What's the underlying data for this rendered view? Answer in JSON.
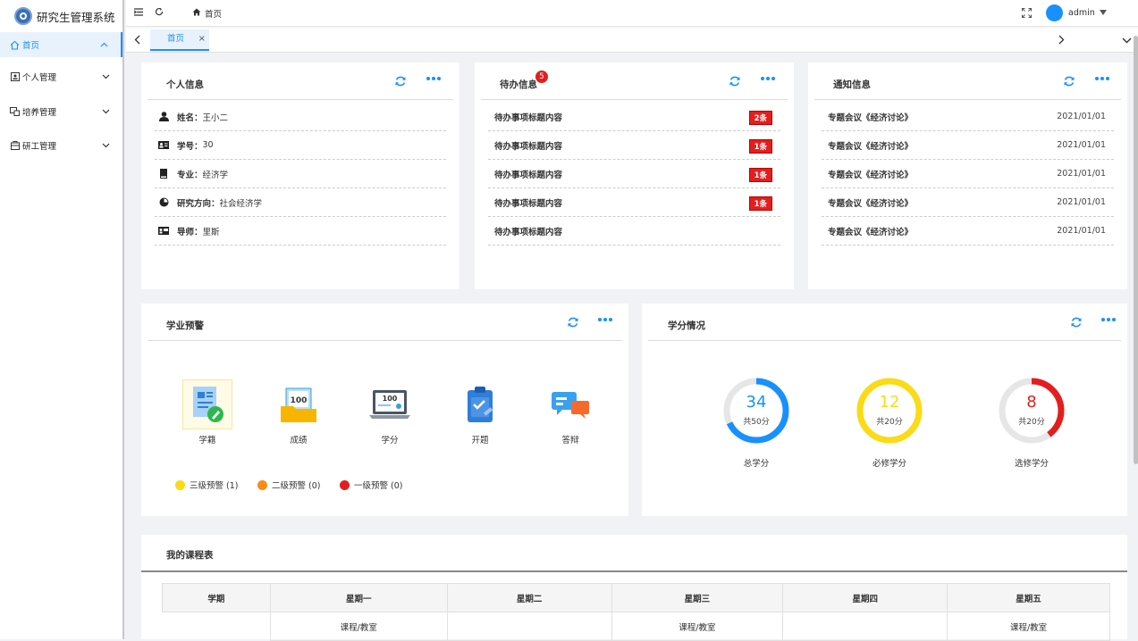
{
  "app": {
    "title": "研究生管理系统"
  },
  "sidebar": {
    "items": [
      {
        "label": "首页",
        "icon": "home-icon"
      },
      {
        "label": "个人管理",
        "icon": "person-card-icon"
      },
      {
        "label": "培养管理",
        "icon": "training-icon"
      },
      {
        "label": "研工管理",
        "icon": "research-icon"
      }
    ]
  },
  "topbar": {
    "breadcrumb": "首页",
    "user": "admin"
  },
  "tabs": [
    {
      "label": "首页",
      "close": "×"
    }
  ],
  "personal": {
    "title": "个人信息",
    "rows": [
      {
        "k": "姓名：",
        "v": "王小二"
      },
      {
        "k": "学号：",
        "v": "30"
      },
      {
        "k": "专业：",
        "v": "经济学"
      },
      {
        "k": "研究方向：",
        "v": "社会经济学"
      },
      {
        "k": "导师：",
        "v": "里斯"
      }
    ]
  },
  "todo": {
    "title": "待办信息",
    "count": "5",
    "rows": [
      {
        "text": "待办事项标题内容",
        "badge": "2条"
      },
      {
        "text": "待办事项标题内容",
        "badge": "1条"
      },
      {
        "text": "待办事项标题内容",
        "badge": "1条"
      },
      {
        "text": "待办事项标题内容",
        "badge": "1条"
      },
      {
        "text": "待办事项标题内容",
        "badge": ""
      }
    ]
  },
  "notice": {
    "title": "通知信息",
    "rows": [
      {
        "text": "专题会议《经济讨论》",
        "date": "2021/01/01"
      },
      {
        "text": "专题会议《经济讨论》",
        "date": "2021/01/01"
      },
      {
        "text": "专题会议《经济讨论》",
        "date": "2021/01/01"
      },
      {
        "text": "专题会议《经济讨论》",
        "date": "2021/01/01"
      },
      {
        "text": "专题会议《经济讨论》",
        "date": "2021/01/01"
      }
    ]
  },
  "warning": {
    "title": "学业预警",
    "items": [
      "学籍",
      "成绩",
      "学分",
      "开题",
      "答辩"
    ],
    "score_text": "100",
    "legend": [
      {
        "label": "三级预警 (1)",
        "color": "#fadb14"
      },
      {
        "label": "二级预警 (0)",
        "color": "#fa8c16"
      },
      {
        "label": "一级预警 (0)",
        "color": "#e31e1e"
      }
    ]
  },
  "credits": {
    "title": "学分情况",
    "items": [
      {
        "value": "34",
        "total": "共50分",
        "label": "总学分",
        "color": "#1890ff",
        "fraction": 0.68
      },
      {
        "value": "12",
        "total": "共20分",
        "label": "必修学分",
        "color": "#fadb14",
        "fraction": 1.0
      },
      {
        "value": "8",
        "total": "共20分",
        "label": "选修学分",
        "color": "#e31e1e",
        "fraction": 0.4
      }
    ]
  },
  "schedule": {
    "title": "我的课程表",
    "headers": [
      "学期",
      "星期一",
      "星期二",
      "星期三",
      "星期四",
      "星期五"
    ],
    "row1": [
      "",
      "课程/教室",
      "",
      "课程/教室",
      "",
      "课程/教室"
    ]
  },
  "colors": {
    "accent": "#1890ff",
    "danger": "#e31e1e"
  }
}
